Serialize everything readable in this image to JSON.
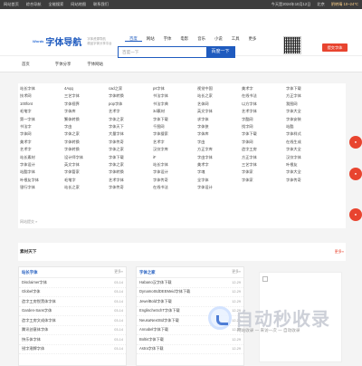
{
  "topbar": {
    "links": [
      "网站首页",
      "综合导航",
      "全能搜索",
      "网站地图",
      "联系我们"
    ],
    "date": "今天是2024年10月12日",
    "weather_city": "北京",
    "weather": "阴转晴 10~24℃"
  },
  "header": {
    "badge": "Words",
    "site_name": "字体导航",
    "sub1": "字体资源导航",
    "sub2": "精品字体分享平台",
    "search_tabs": [
      "百度",
      "网站",
      "字体",
      "电影",
      "音乐",
      "小说",
      "工具",
      "更多"
    ],
    "search_placeholder": "百度一下",
    "search_button": "百度一下",
    "submit_button": "提交字体"
  },
  "nav": [
    "首页",
    "字体分享",
    "字体网站"
  ],
  "links": [
    "站长字体",
    "4Aqq",
    "cad之家",
    "ps字体",
    "视觉中国",
    "美术字",
    "字体下载",
    "技术网",
    "三艺字体",
    "字体转换",
    "书法字体",
    "站长之家",
    "在线书法",
    "方正字体",
    "100font",
    "字体视界",
    "pop字体",
    "书法字典",
    "艺体网",
    "以方字体",
    "我图网",
    "毛笔字",
    "字体库",
    "艺术字",
    "3d素材",
    "英文字体",
    "艺术字体",
    "字体大全",
    "第一字体",
    "繁体转换",
    "字体之家",
    "字体下载",
    "求字体",
    "字酷网",
    "字体安装",
    "书法字",
    "字由",
    "字体天下",
    "千图网",
    "字体侠",
    "找字网",
    "站酷",
    "字体网",
    "字体之家",
    "大量字体",
    "字体搜索",
    "字体库",
    "字体下载",
    "字体样式",
    "美术字",
    "字体转换",
    "字体传奇",
    "艺术字",
    "字由",
    "字体网",
    "在线生成",
    "艺术字",
    "字体转换",
    "字体之家",
    "汉仪字库",
    "方正字库",
    "造字工房",
    "字体大全",
    "站长素材",
    "设计师字体",
    "字体下载",
    "iF",
    "字由字体",
    "方正字体",
    "汉仪字体",
    "字体设计",
    "英文字体",
    "字体之家",
    "站长字体",
    "美术字",
    "三艺字体",
    "叶根友",
    "站酷字体",
    "字体管家",
    "字体转换",
    "字体设计",
    "字魂",
    "字体家",
    "字体大全",
    "叶根友字体",
    "毛笔字",
    "艺术字体",
    "字体传奇",
    "全字体",
    "字体家",
    "字体传奇",
    "银行字体",
    "站长之家",
    "字体传奇",
    "在线书法",
    "字体设计"
  ],
  "links_more": "网站提交 »",
  "section": {
    "title": "素材天下",
    "more": "更多»"
  },
  "cards": [
    {
      "title": "站长字体",
      "more": "更多»",
      "rows": [
        {
          "n": "Disclaimer字体",
          "d": "03-14"
        },
        {
          "n": "Globel字体",
          "d": "03-14"
        },
        {
          "n": "造字工房悦黑体字体",
          "d": "03-14"
        },
        {
          "n": "Garden-Sans字体",
          "d": "03-14"
        },
        {
          "n": "造字工房文成体字体",
          "d": "03-14"
        },
        {
          "n": "腾讯创意体字体",
          "d": "03-14"
        },
        {
          "n": "快乐体字体",
          "d": "03-14"
        },
        {
          "n": "锐字潮牌字体",
          "d": "03-14"
        }
      ]
    },
    {
      "title": "字体之家",
      "more": "更多»",
      "rows": [
        {
          "n": "Habano汉字体下载",
          "d": "12-29"
        },
        {
          "n": "DynamoStdDEEMeid字体下载",
          "d": "12-29"
        },
        {
          "n": "JewelBold字体下载",
          "d": "12-29"
        },
        {
          "n": "EnglischeSchT字体下载",
          "d": "12-29"
        },
        {
          "n": "NeusaNextStd字体下载",
          "d": "12-29"
        },
        {
          "n": "Annabel字体下载",
          "d": "12-29"
        },
        {
          "n": "Boltis字体下载",
          "d": "12-29"
        },
        {
          "n": "Astra字体下载",
          "d": "12-29"
        }
      ]
    }
  ],
  "watermark": {
    "text": "自动秒收录",
    "sub": "网站收录 一 来访一次 一 自动收录"
  },
  "colors": {
    "accent": "#1f5bbf",
    "red": "#e8442f",
    "topbar": "#3d3d3d"
  }
}
